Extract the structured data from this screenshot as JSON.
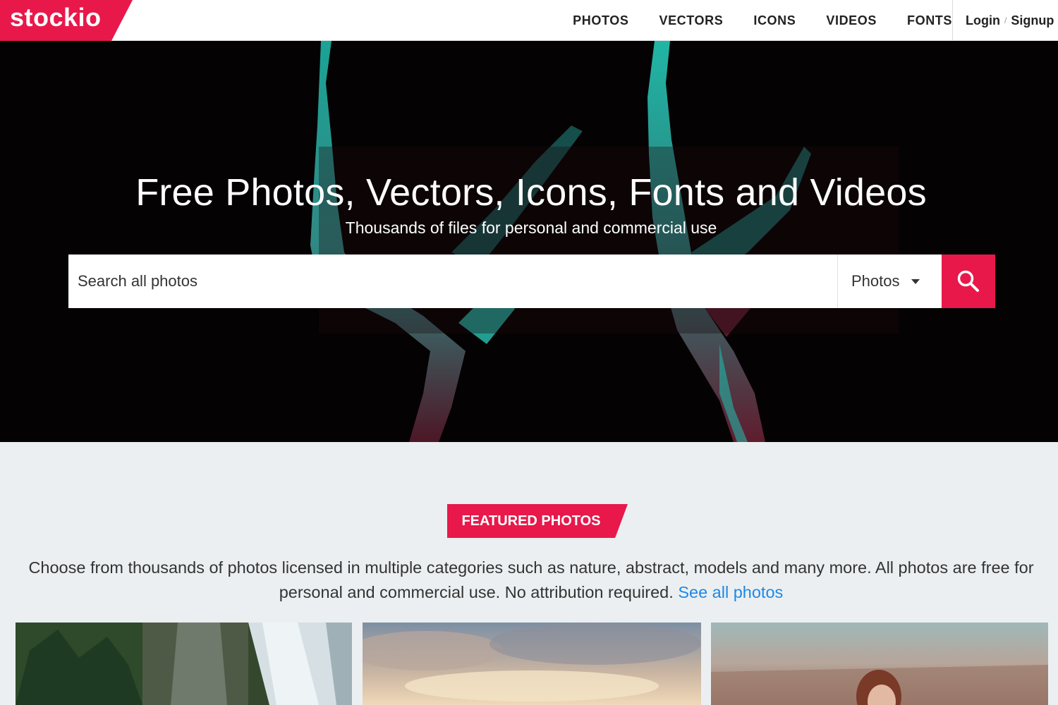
{
  "header": {
    "logo_text": "stockio",
    "nav": [
      {
        "label": "PHOTOS"
      },
      {
        "label": "VECTORS"
      },
      {
        "label": "ICONS"
      },
      {
        "label": "VIDEOS"
      },
      {
        "label": "FONTS"
      }
    ],
    "login_label": "Login",
    "auth_separator": "/",
    "signup_label": "Signup"
  },
  "hero": {
    "title": "Free Photos, Vectors, Icons, Fonts and Videos",
    "subtitle": "Thousands of files for personal and commercial use",
    "background_image": "antlers-on-dark-background",
    "search": {
      "placeholder": "Search all photos",
      "category_selected": "Photos",
      "button_icon": "search-icon"
    }
  },
  "featured": {
    "badge": "FEATURED PHOTOS",
    "description": "Choose from thousands of photos licensed in multiple categories such as nature, abstract, models and many more. All photos are free for personal and commercial use. No attribution required.",
    "see_all_link": "See all photos",
    "photos": [
      {
        "subject": "waterfall-cliff"
      },
      {
        "subject": "sky-clouds"
      },
      {
        "subject": "woman-in-field"
      }
    ]
  },
  "colors": {
    "accent": "#e8184a",
    "link": "#1e88e5",
    "page_background": "#eceff1",
    "header_background": "#ffffff"
  }
}
